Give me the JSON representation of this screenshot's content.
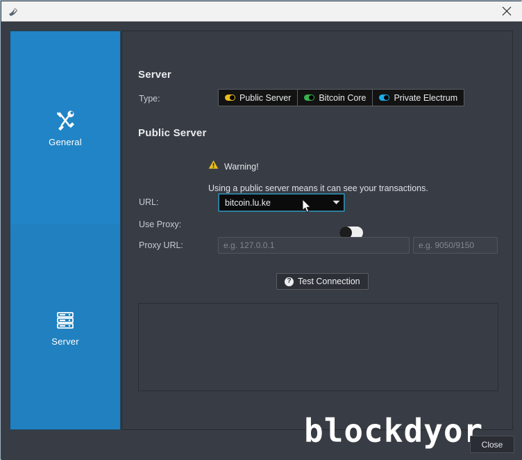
{
  "window": {
    "app_icon": "bird-icon",
    "close_icon": "close-icon"
  },
  "sidebar": {
    "items": [
      {
        "label": "General",
        "icon": "tools-icon",
        "selected": false
      },
      {
        "label": "Server",
        "icon": "server-rack-icon",
        "selected": true
      }
    ]
  },
  "main": {
    "server_section_title": "Server",
    "type_label": "Type:",
    "type_options": [
      {
        "label": "Public Server",
        "color": "#e8bd1c",
        "selected": true
      },
      {
        "label": "Bitcoin Core",
        "color": "#37b24d",
        "selected": false
      },
      {
        "label": "Private Electrum",
        "color": "#1cabe8",
        "selected": false
      }
    ],
    "public_section_title": "Public Server",
    "warning_icon": "warning-triangle-icon",
    "warning_title": "Warning!",
    "warning_text": "Using a public server means it can see your transactions.",
    "url_label": "URL:",
    "url_value": "bitcoin.lu.ke",
    "url_dropdown_icon": "chevron-down-icon",
    "use_proxy_label": "Use Proxy:",
    "use_proxy_state": "off",
    "proxy_url_label": "Proxy URL:",
    "proxy_host_placeholder": "e.g. 127.0.0.1",
    "proxy_port_placeholder": "e.g. 9050/9150",
    "test_button_label": "Test Connection",
    "test_button_icon": "question-circle-icon",
    "log_output": ""
  },
  "footer": {
    "watermark": "blockdyor",
    "close_label": "Close"
  },
  "colors": {
    "sidebar_blue": "#2184c6",
    "panel_bg": "#383c44",
    "accent_focus": "#2e7e9e",
    "warning_yellow": "#e8bd1c"
  }
}
